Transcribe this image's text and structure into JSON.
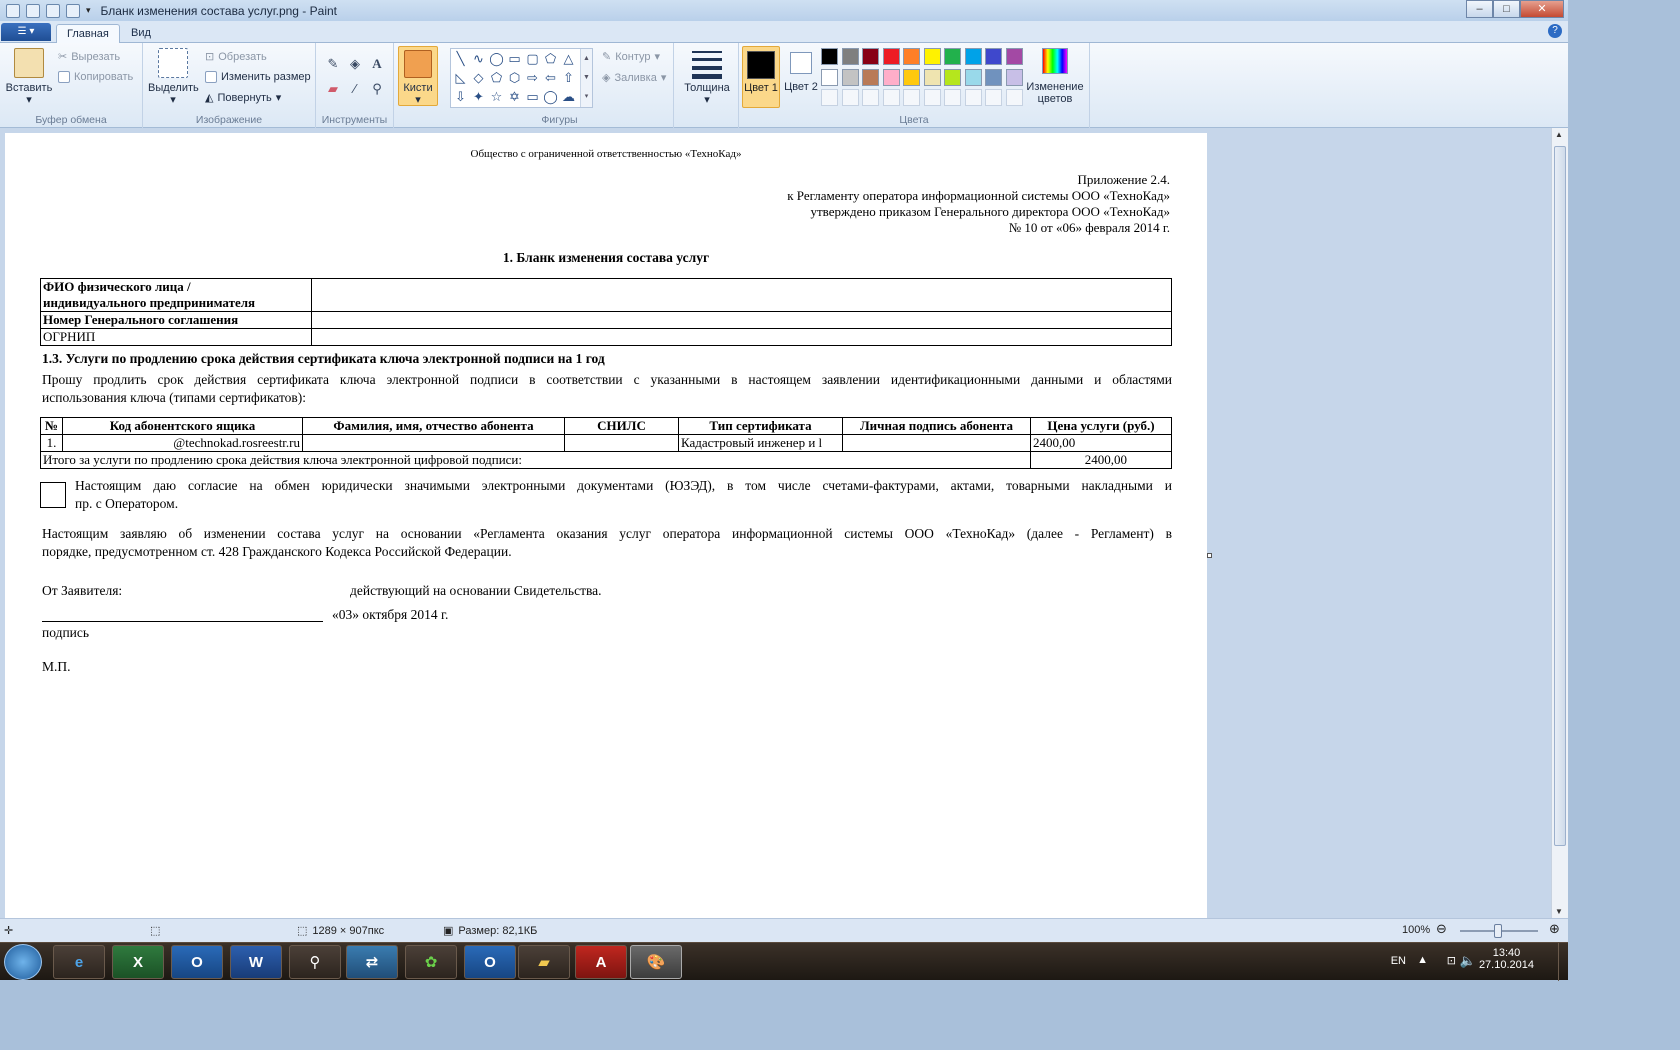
{
  "window": {
    "title": "Бланк изменения состава услуг.png - Paint",
    "buttons": [
      "–",
      "□",
      "✕"
    ]
  },
  "tabs": {
    "main": "Главная",
    "view": "Вид"
  },
  "ribbon": {
    "clipboard": {
      "paste": "Вставить",
      "cut": "Вырезать",
      "copy": "Копировать",
      "label": "Буфер обмена"
    },
    "image": {
      "select": "Выделить",
      "crop": "Обрезать",
      "resize": "Изменить размер",
      "rotate": "Повернуть",
      "label": "Изображение"
    },
    "tools": {
      "label": "Инструменты"
    },
    "brushes": {
      "label": "Кисти"
    },
    "shapes": {
      "outline": "Контур",
      "fill": "Заливка",
      "label": "Фигуры"
    },
    "size": {
      "label": "Толщина"
    },
    "colors": {
      "color1": "Цвет 1",
      "color2": "Цвет 2",
      "edit": "Изменение цветов",
      "label": "Цвета",
      "palette": [
        "#000000",
        "#7f7f7f",
        "#880015",
        "#ed1c24",
        "#ff7f27",
        "#fff200",
        "#22b14c",
        "#00a2e8",
        "#3f48cc",
        "#a349a4",
        "#ffffff",
        "#c3c3c3",
        "#b97a57",
        "#ffaec9",
        "#ffc90e",
        "#efe4b0",
        "#b5e61d",
        "#99d9ea",
        "#7092be",
        "#c8bfe7"
      ]
    }
  },
  "doc": {
    "org": "Общество с ограниченной ответственностью «ТехноКад»",
    "app1": "Приложение 2.4.",
    "app2": "к Регламенту оператора  информационной системы ООО «ТехноКад»",
    "app3": "утверждено приказом Генерального директора ООО «ТехноКад»",
    "app4": "№ 10 от «06» февраля 2014 г.",
    "title": "1. Бланк изменения состава услуг",
    "t1r1": "ФИО физического лица /",
    "t1r1b": "индивидуального предпринимателя",
    "t1r2": "Номер Генерального соглашения",
    "t1r3": "ОГРНИП",
    "sect": "1.3. Услуги по продлению срока действия сертификата ключа электронной подписи на 1 год",
    "req1": "Прошу продлить срок действия сертификата ключа электронной подписи в соответствии с указанными в настоящем заявлении идентификационными данными и областями",
    "req2": "использования ключа (типами сертификатов):",
    "headers": [
      "№",
      "Код абонентского ящика",
      "Фамилия, имя, отчество абонента",
      "СНИЛС",
      "Тип сертификата",
      "Личная подпись абонента",
      "Цена услуги (руб.)"
    ],
    "row": [
      "1.",
      "@technokad.rosreestr.ru",
      "",
      "",
      "Кадастровый инженер и l",
      "",
      "2400,00"
    ],
    "total_label": "Итого за услуги по продлению срока действия ключа электронной цифровой подписи:",
    "total_value": "2400,00",
    "consent1": "Настоящим даю согласие на обмен юридически значимыми электронными документами (ЮЗЭД), в том числе счетами-фактурами, актами, товарными накладными и",
    "consent2": "пр. с Оператором.",
    "basis1": "Настоящим заявляю об изменении состава услуг на основании  «Регламента оказания услуг оператора информационной системы ООО «ТехноКад» (далее - Регламент) в",
    "basis2": "порядке, предусмотренном ст. 428 Гражданского Кодекса Российской Федерации.",
    "from": "От Заявителя:",
    "acting": "действующий на основании Свидетельства.",
    "date": "«03» октября 2014 г.",
    "sign": "подпись",
    "mp": "М.П."
  },
  "status": {
    "dims": "1289 × 907пкс",
    "size": "Размер: 82,1КБ",
    "zoom": "100%"
  },
  "tray": {
    "lang": "EN",
    "time": "13:40",
    "date": "27.10.2014"
  },
  "taskbar": {
    "excel": "X",
    "outlook": "O",
    "word": "W",
    "acrobat": "A"
  }
}
